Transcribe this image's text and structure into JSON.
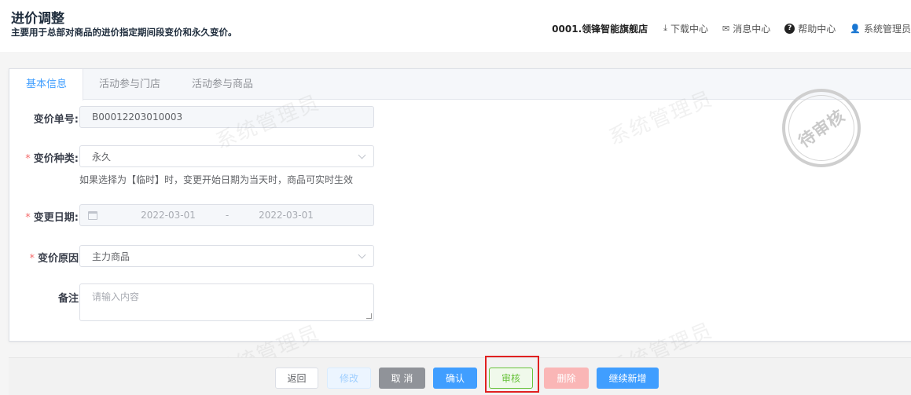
{
  "header": {
    "title": "进价调整",
    "subtitle": "主要用于总部对商品的进价指定期间段变价和永久变价。",
    "store": "0001.领锋智能旗舰店",
    "links": {
      "download": "下载中心",
      "messages": "消息中心",
      "help": "帮助中心",
      "user": "系统管理员"
    }
  },
  "tabs": [
    "基本信息",
    "活动参与门店",
    "活动参与商品"
  ],
  "form": {
    "order_no": {
      "label": "变价单号:",
      "value": "B00012203010003"
    },
    "price_type": {
      "label": "变价种类:",
      "value": "永久",
      "hint": "如果选择为【临时】时，变更开始日期为当天时，商品可实时生效"
    },
    "change_date": {
      "label": "变更日期:",
      "start": "2022-03-01",
      "separator": "-",
      "end": "2022-03-01"
    },
    "reason": {
      "label": "变价原因",
      "value": "主力商品"
    },
    "remark": {
      "label": "备注",
      "placeholder": "请输入内容"
    }
  },
  "stamp": "待审核",
  "watermark": "系统管理员",
  "buttons": {
    "back": "返回",
    "edit": "修改",
    "cancel": "取 消",
    "confirm": "确认",
    "audit": "审核",
    "delete": "删除",
    "continue": "继续新增"
  },
  "colors": {
    "primary": "#409eff",
    "danger": "#f56c6c",
    "success": "#67c23a",
    "highlight": "#e02020"
  }
}
